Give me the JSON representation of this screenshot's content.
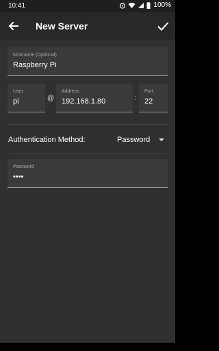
{
  "status": {
    "time": "10:41",
    "battery": "100%"
  },
  "appbar": {
    "title": "New Server"
  },
  "form": {
    "nickname": {
      "label": "Nickname (Optional)",
      "value": "Raspberry Pi"
    },
    "user": {
      "label": "User",
      "value": "pi"
    },
    "at_sign": "@",
    "address": {
      "label": "Address",
      "value": "192.168.1.80"
    },
    "colon": ":",
    "port": {
      "label": "Port",
      "value": "22"
    },
    "auth": {
      "label": "Authentication Method:",
      "selected": "Password"
    },
    "password": {
      "label": "Password",
      "value": "••••"
    }
  }
}
